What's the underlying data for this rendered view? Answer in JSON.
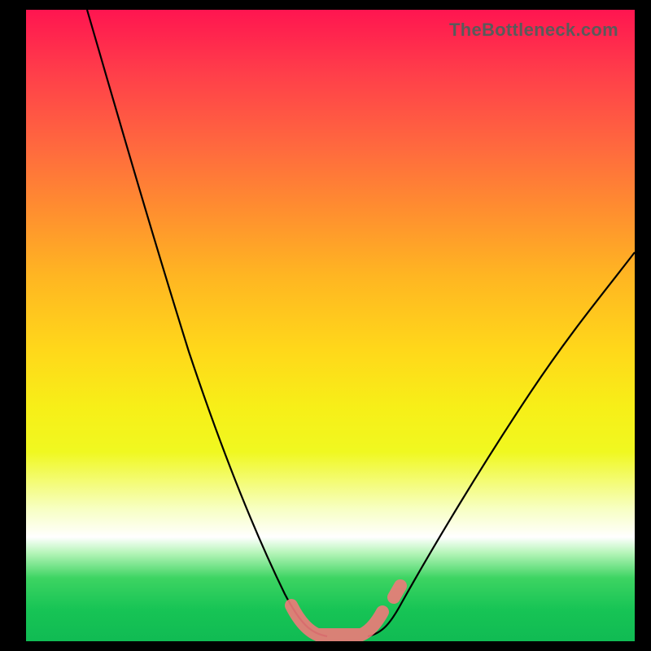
{
  "watermark": "TheBottleneck.com",
  "chart_data": {
    "type": "line",
    "title": "",
    "xlabel": "",
    "ylabel": "",
    "xlim": [
      0,
      100
    ],
    "ylim": [
      0,
      100
    ],
    "grid": false,
    "legend": false,
    "series": [
      {
        "name": "left-branch",
        "x": [
          10,
          15,
          20,
          25,
          30,
          35,
          40,
          43,
          46,
          48,
          50
        ],
        "y": [
          100,
          84,
          68,
          53,
          38,
          25,
          14,
          8,
          4,
          1.5,
          0.5
        ]
      },
      {
        "name": "right-branch",
        "x": [
          56,
          58,
          61,
          65,
          70,
          76,
          82,
          88,
          94,
          100
        ],
        "y": [
          0.5,
          2,
          5,
          10,
          18,
          28,
          38,
          47,
          55,
          62
        ]
      }
    ],
    "annotations": [
      {
        "name": "optimal-range-marker",
        "shape": "band",
        "x_range": [
          44,
          58
        ],
        "y": 1.5,
        "color": "#f07a7a"
      }
    ],
    "background_gradient": {
      "top": "#ff1550",
      "mid": "#ffd81a",
      "bottom": "#10bb53"
    }
  }
}
